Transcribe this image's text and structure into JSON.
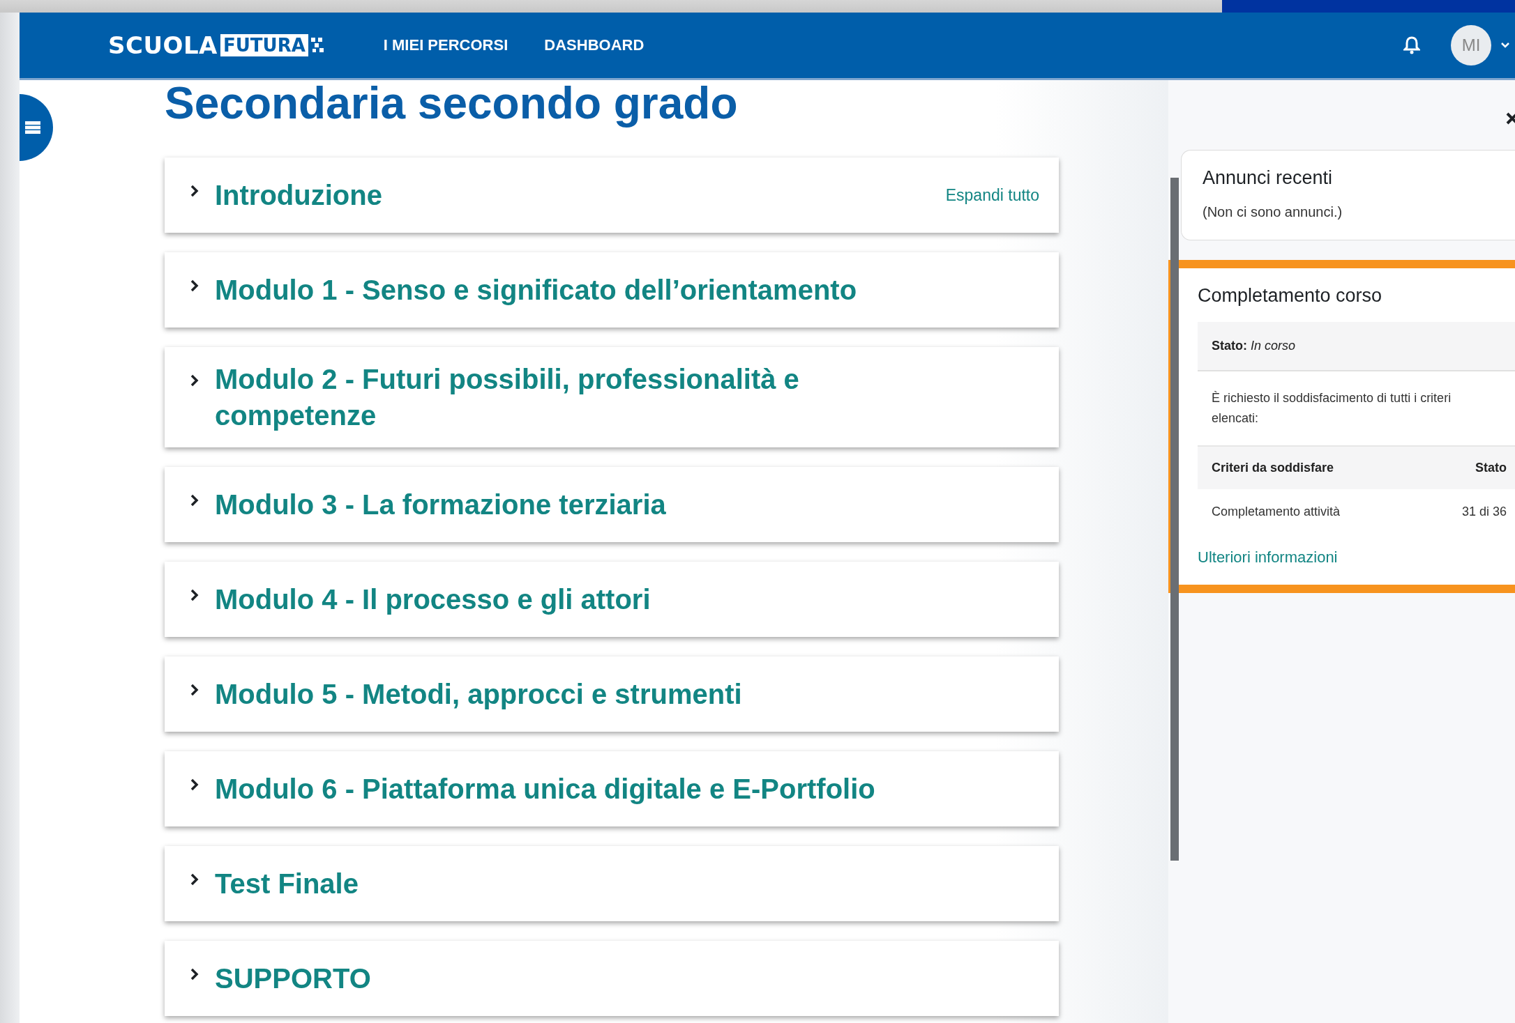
{
  "header": {
    "logo": {
      "part_1": "SCUOLA",
      "part_2": "FUTURA"
    },
    "nav": [
      {
        "label": "I MIEI PERCORSI"
      },
      {
        "label": "DASHBOARD"
      }
    ],
    "avatar": "MI"
  },
  "page": {
    "title": "Secondaria secondo grado",
    "expand_all": "Espandi tutto",
    "sections": [
      {
        "title": "Introduzione",
        "expanded": false
      },
      {
        "title": "Modulo 1 - Senso e significato dell’orientamento",
        "expanded": false
      },
      {
        "title": "Modulo 2 - Futuri possibili, professionalità e competenze",
        "expanded": false
      },
      {
        "title": "Modulo 3 - La formazione terziaria",
        "expanded": false
      },
      {
        "title": "Modulo 4 - Il processo e gli attori",
        "expanded": false
      },
      {
        "title": "Modulo 5 - Metodi, approcci e strumenti",
        "expanded": false
      },
      {
        "title": "Modulo 6 - Piattaforma unica digitale e E-Portfolio",
        "expanded": false
      },
      {
        "title": "Test Finale",
        "expanded": false
      },
      {
        "title": "SUPPORTO",
        "expanded": false
      }
    ]
  },
  "drawer": {
    "announcements": {
      "title": "Annunci recenti",
      "empty_text": "(Non ci sono annunci.)"
    },
    "completion": {
      "title": "Completamento corso",
      "highlighted": true,
      "status": "**Stato:** *In corso*",
      "requirement": "È richiesto il soddisfacimento di tutti i criteri elencati:",
      "columns": [
        "Criteri da soddisfare",
        "Stato"
      ],
      "rows": [
        [
          "Completamento attività",
          "31 di 36"
        ]
      ],
      "more_link": "Ulteriori informazioni"
    }
  }
}
